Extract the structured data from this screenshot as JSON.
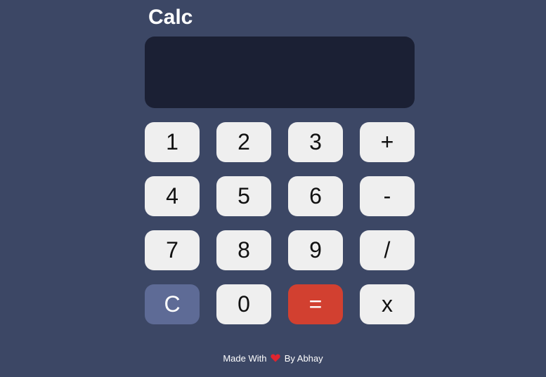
{
  "app": {
    "title": "Calc"
  },
  "display": {
    "value": ""
  },
  "buttons": {
    "one": "1",
    "two": "2",
    "three": "3",
    "plus": "+",
    "four": "4",
    "five": "5",
    "six": "6",
    "minus": "-",
    "seven": "7",
    "eight": "8",
    "nine": "9",
    "divide": "/",
    "clear": "C",
    "zero": "0",
    "equals": "=",
    "multiply": "x"
  },
  "footer": {
    "made_with": "Made With",
    "heart_icon": "heart-icon",
    "by": "By Abhay"
  },
  "colors": {
    "background": "#3c4765",
    "display": "#1b2034",
    "button": "#efefef",
    "clear_button": "#5e6b96",
    "equals_button": "#d24030",
    "heart": "#e0242e"
  }
}
